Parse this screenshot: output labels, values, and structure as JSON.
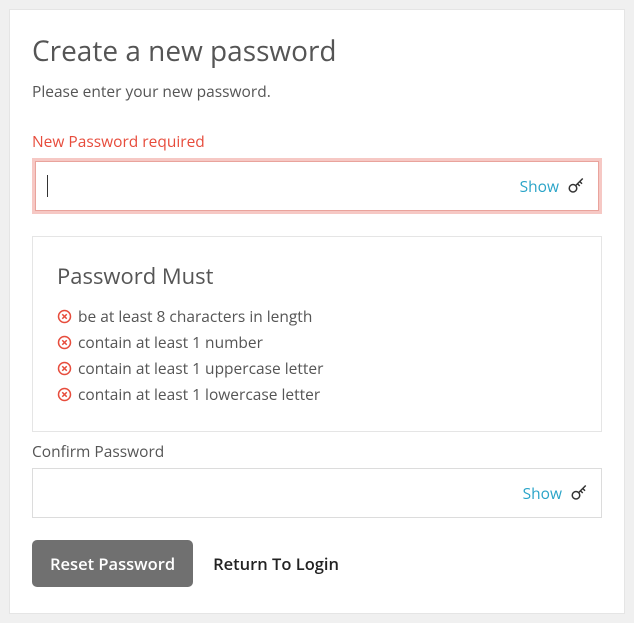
{
  "title": "Create a new password",
  "subtitle": "Please enter your new password.",
  "newPassword": {
    "labelError": "New Password required",
    "value": "",
    "showLabel": "Show"
  },
  "rules": {
    "title": "Password Must",
    "items": [
      "be at least 8 characters in length",
      "contain at least 1 number",
      "contain at least 1 uppercase letter",
      "contain at least 1 lowercase letter"
    ]
  },
  "confirmPassword": {
    "label": "Confirm Password",
    "value": "",
    "showLabel": "Show"
  },
  "buttons": {
    "reset": "Reset Password",
    "return": "Return To Login"
  },
  "colors": {
    "error": "#e74c3c",
    "link": "#2aa4c8",
    "primaryBtn": "#707070"
  }
}
